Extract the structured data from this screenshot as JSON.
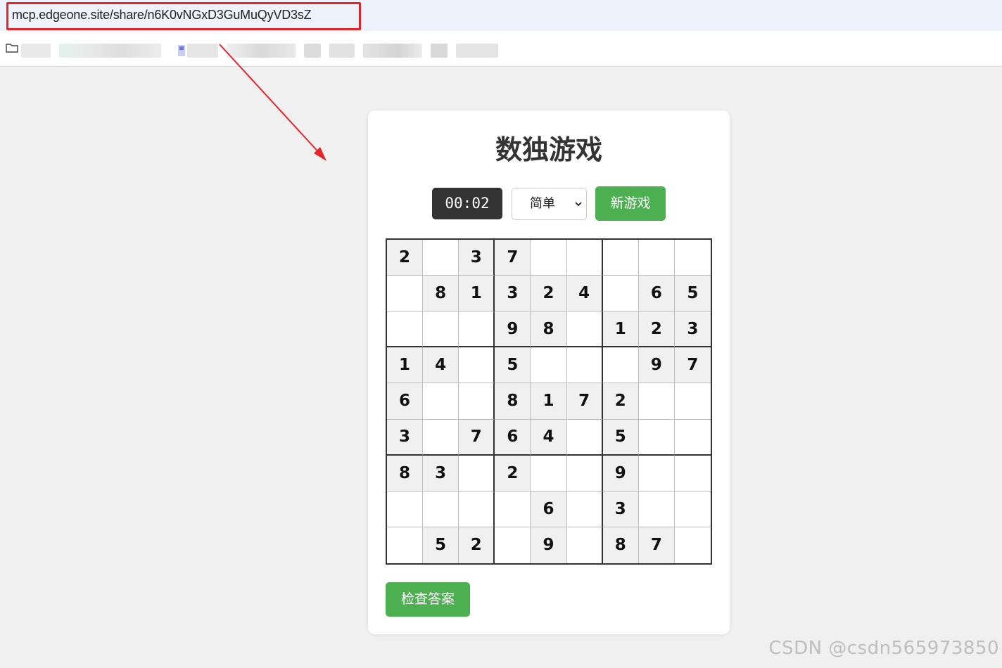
{
  "browser": {
    "url": "mcp.edgeone.site/share/n6K0vNGxD3GuMuQyVD3sZ"
  },
  "game": {
    "title": "数独游戏",
    "timer": "00:02",
    "difficulty_selected": "简单",
    "new_game_label": "新游戏",
    "check_label": "检查答案",
    "board": [
      [
        "2",
        "",
        "3",
        "7",
        "",
        "",
        "",
        "",
        ""
      ],
      [
        "",
        "8",
        "1",
        "3",
        "2",
        "4",
        "",
        "6",
        "5"
      ],
      [
        "",
        "",
        "",
        "9",
        "8",
        "",
        "1",
        "2",
        "3"
      ],
      [
        "1",
        "4",
        "",
        "5",
        "",
        "",
        "",
        "9",
        "7"
      ],
      [
        "6",
        "",
        "",
        "8",
        "1",
        "7",
        "2",
        "",
        ""
      ],
      [
        "3",
        "",
        "7",
        "6",
        "4",
        "",
        "5",
        "",
        ""
      ],
      [
        "8",
        "3",
        "",
        "2",
        "",
        "",
        "9",
        "",
        ""
      ],
      [
        "",
        "",
        "",
        "",
        "6",
        "",
        "3",
        "",
        ""
      ],
      [
        "",
        "5",
        "2",
        "",
        "9",
        "",
        "8",
        "7",
        ""
      ]
    ]
  },
  "watermark": "CSDN @csdn565973850",
  "colors": {
    "accent_green": "#4caf50",
    "timer_bg": "#333333",
    "given_cell_bg": "#f0f0f0",
    "highlight_red": "#e8232a"
  }
}
